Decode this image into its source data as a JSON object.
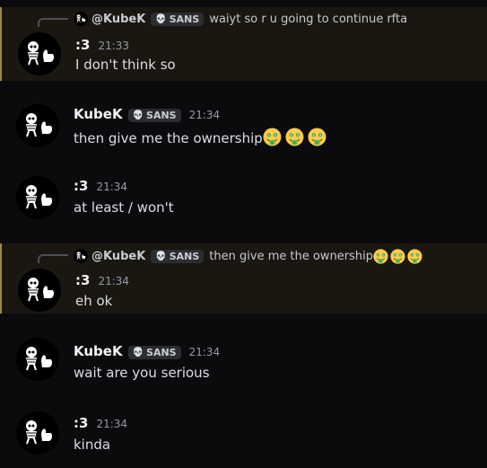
{
  "messages": [
    {
      "username": ":3",
      "timestamp": "21:33",
      "text": "I don't think so",
      "reply": {
        "mention": "@KubeK",
        "tag": "SANS",
        "text": "waiyt so r u going to continue rfta"
      },
      "avatar_label": "Samsy"
    },
    {
      "username": "KubeK",
      "tag": "SANS",
      "timestamp": "21:34",
      "text": "then give me the ownership",
      "emojis": [
        "money-mouth-emoji",
        "money-mouth-emoji",
        "money-mouth-emoji"
      ],
      "avatar_label": "KubeK"
    },
    {
      "username": ":3",
      "timestamp": "21:34",
      "text": "at least / won't",
      "avatar_label": "Samsy"
    },
    {
      "username": ":3",
      "timestamp": "21:34",
      "text": "eh ok",
      "reply": {
        "mention": "@KubeK",
        "tag": "SANS",
        "text": "then give me the ownership",
        "emojis": [
          "money-mouth-emoji",
          "money-mouth-emoji",
          "money-mouth-emoji"
        ]
      },
      "avatar_label": "Samsy"
    },
    {
      "username": "KubeK",
      "tag": "SANS",
      "timestamp": "21:34",
      "text": "wait are you serious",
      "avatar_label": "KubeK"
    },
    {
      "username": ":3",
      "timestamp": "21:34",
      "text": "kinda",
      "avatar_label": "Samsy"
    }
  ],
  "colors": {
    "background": "#0b0b0e",
    "highlight": "#1a1711",
    "highlight_border": "#a38a3c",
    "username": "#f2f3f5"
  }
}
